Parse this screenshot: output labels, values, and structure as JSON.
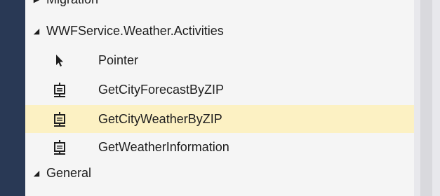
{
  "toolbox": {
    "partial_group": {
      "label": "Migration",
      "icon": "collapsed-triangle-icon"
    },
    "groups": [
      {
        "label": "WWFService.Weather.Activities",
        "icon": "expanded-triangle-icon",
        "items": [
          {
            "label": "Pointer",
            "icon": "pointer-arrow-icon"
          },
          {
            "label": "GetCityForecastByZIP",
            "icon": "activity-icon"
          },
          {
            "label": "GetCityWeatherByZIP",
            "icon": "activity-icon",
            "selected": true
          },
          {
            "label": "GetWeatherInformation",
            "icon": "activity-icon"
          }
        ]
      },
      {
        "label": "General",
        "icon": "expanded-triangle-icon",
        "items": []
      }
    ]
  },
  "colors": {
    "sidebar": "#293955",
    "panel_bg": "#f5f5f5",
    "selected_bg": "#fcf1c3",
    "scrollbar": "#d9d9dd"
  }
}
